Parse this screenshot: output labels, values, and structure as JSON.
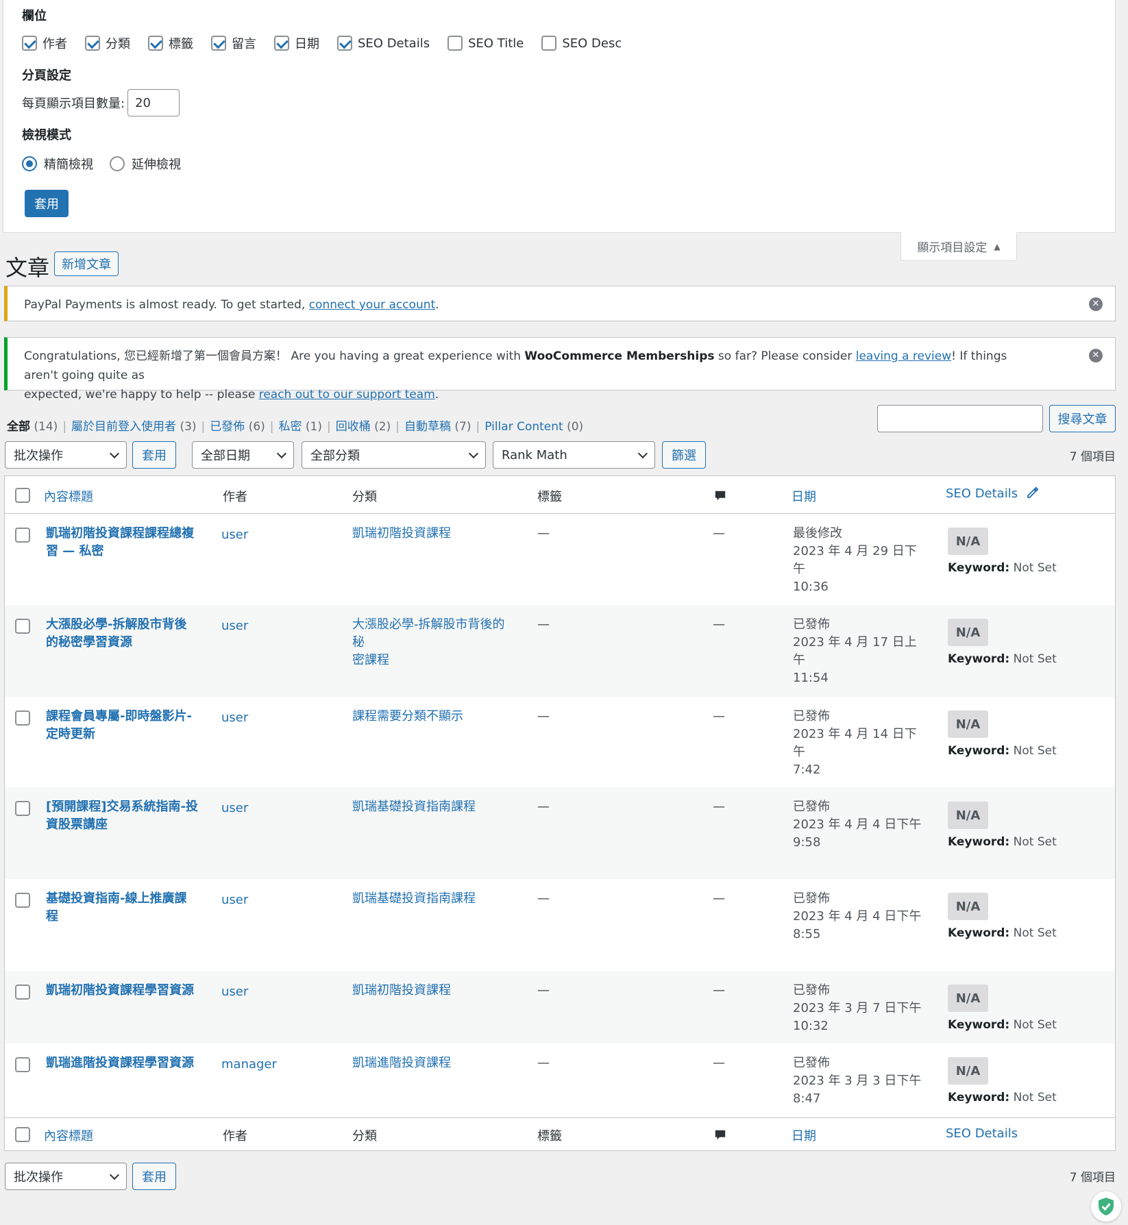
{
  "screen_options": {
    "columns_heading": "欄位",
    "columns": [
      {
        "label": "作者",
        "checked": true
      },
      {
        "label": "分類",
        "checked": true
      },
      {
        "label": "標籤",
        "checked": true
      },
      {
        "label": "留言",
        "checked": true
      },
      {
        "label": "日期",
        "checked": true
      },
      {
        "label": "SEO Details",
        "checked": true
      },
      {
        "label": "SEO Title",
        "checked": false
      },
      {
        "label": "SEO Desc",
        "checked": false
      }
    ],
    "pagination_heading": "分頁設定",
    "per_page_label": "每頁顯示項目數量:",
    "per_page_value": "20",
    "view_mode_heading": "檢視模式",
    "view_modes": [
      {
        "label": "精簡檢視",
        "checked": true
      },
      {
        "label": "延伸檢視",
        "checked": false
      }
    ],
    "apply_label": "套用",
    "tab_label": "顯示項目設定"
  },
  "page": {
    "title": "文章",
    "add_new_label": "新增文章"
  },
  "notices": {
    "paypal": {
      "text_before": "PayPal Payments is almost ready. To get started, ",
      "link": "connect your account",
      "text_after": "."
    },
    "memberships": {
      "text1": "Congratulations, 您已經新增了第一個會員方案！ Are you having a great experience with ",
      "bold": "WooCommerce Memberships",
      "text2": " so far? Please consider ",
      "link1": "leaving a review",
      "text3": "! If things aren't going quite as",
      "text4": "expected, we're happy to help -- please ",
      "link2": "reach out to our support team",
      "text5": "."
    }
  },
  "views": {
    "all_label": "全部",
    "all_count": "(14)",
    "mine_label": "屬於目前登入使用者",
    "mine_count": "(3)",
    "publish_label": "已發佈",
    "publish_count": "(6)",
    "private_label": "私密",
    "private_count": "(1)",
    "trash_label": "回收桶",
    "trash_count": "(2)",
    "draft_label": "自動草稿",
    "draft_count": "(7)",
    "pillar_label": "Pillar Content",
    "pillar_count": "(0)"
  },
  "search": {
    "value": "",
    "button_label": "搜尋文章"
  },
  "filters": {
    "bulk_label": "批次操作",
    "apply_label": "套用",
    "date_label": "全部日期",
    "category_label": "全部分類",
    "seo_label": "Rank Math",
    "filter_label": "篩選",
    "count_label": "7 個項目"
  },
  "table": {
    "headers": {
      "title": "內容標題",
      "author": "作者",
      "categories": "分類",
      "tags": "標籤",
      "date": "日期",
      "seo": "SEO Details"
    },
    "rows": [
      {
        "title1": "凱瑞初階投資課程課程總複",
        "title2": "習 — 私密",
        "author": "user",
        "cat1": "凱瑞初階投資課程",
        "cat2": "",
        "tags": "—",
        "comments": "—",
        "status": "最後修改",
        "date1": "2023 年 4 月 29 日下午",
        "date2": "10:36",
        "seo": "N/A",
        "kw_label": "Keyword:",
        "kw_value": " Not Set"
      },
      {
        "title1": "大漲股必學-拆解股市背後",
        "title2": "的秘密學習資源",
        "author": "user",
        "cat1": "大漲股必學-拆解股市背後的秘",
        "cat2": "密課程",
        "tags": "—",
        "comments": "—",
        "status": "已發佈",
        "date1": "2023 年 4 月 17 日上午",
        "date2": "11:54",
        "seo": "N/A",
        "kw_label": "Keyword:",
        "kw_value": " Not Set"
      },
      {
        "title1": "課程會員專屬-即時盤影片-",
        "title2": "定時更新",
        "author": "user",
        "cat1": "課程需要分類不顯示",
        "cat2": "",
        "tags": "—",
        "comments": "—",
        "status": "已發佈",
        "date1": "2023 年 4 月 14 日下午",
        "date2": "7:42",
        "seo": "N/A",
        "kw_label": "Keyword:",
        "kw_value": " Not Set"
      },
      {
        "title1": "[預開課程]交易系統指南-投",
        "title2": "資股票講座",
        "author": "user",
        "cat1": "凱瑞基礎投資指南課程",
        "cat2": "",
        "tags": "—",
        "comments": "—",
        "status": "已發佈",
        "date1": "2023 年 4 月 4 日下午",
        "date2": "9:58",
        "seo": "N/A",
        "kw_label": "Keyword:",
        "kw_value": " Not Set"
      },
      {
        "title1": "基礎投資指南-線上推廣課",
        "title2": "程",
        "author": "user",
        "cat1": "凱瑞基礎投資指南課程",
        "cat2": "",
        "tags": "—",
        "comments": "—",
        "status": "已發佈",
        "date1": "2023 年 4 月 4 日下午",
        "date2": "8:55",
        "seo": "N/A",
        "kw_label": "Keyword:",
        "kw_value": " Not Set"
      },
      {
        "title1": "凱瑞初階投資課程學習資源",
        "title2": "",
        "author": "user",
        "cat1": "凱瑞初階投資課程",
        "cat2": "",
        "tags": "—",
        "comments": "—",
        "status": "已發佈",
        "date1": "2023 年 3 月 7 日下午",
        "date2": "10:32",
        "seo": "N/A",
        "kw_label": "Keyword:",
        "kw_value": " Not Set"
      },
      {
        "title1": "凱瑞進階投資課程學習資源",
        "title2": "",
        "author": "manager",
        "cat1": "凱瑞進階投資課程",
        "cat2": "",
        "tags": "—",
        "comments": "—",
        "status": "已發佈",
        "date1": "2023 年 3 月 3 日下午",
        "date2": "8:47",
        "seo": "N/A",
        "kw_label": "Keyword:",
        "kw_value": " Not Set"
      }
    ]
  },
  "bottom": {
    "bulk_label": "批次操作",
    "apply_label": "套用",
    "count_label": "7 個項目"
  },
  "icons": {
    "comments": "comment-bubble-icon",
    "edit": "pencil-icon",
    "dismiss": "dismiss-icon",
    "shield": "shield-check-icon"
  }
}
